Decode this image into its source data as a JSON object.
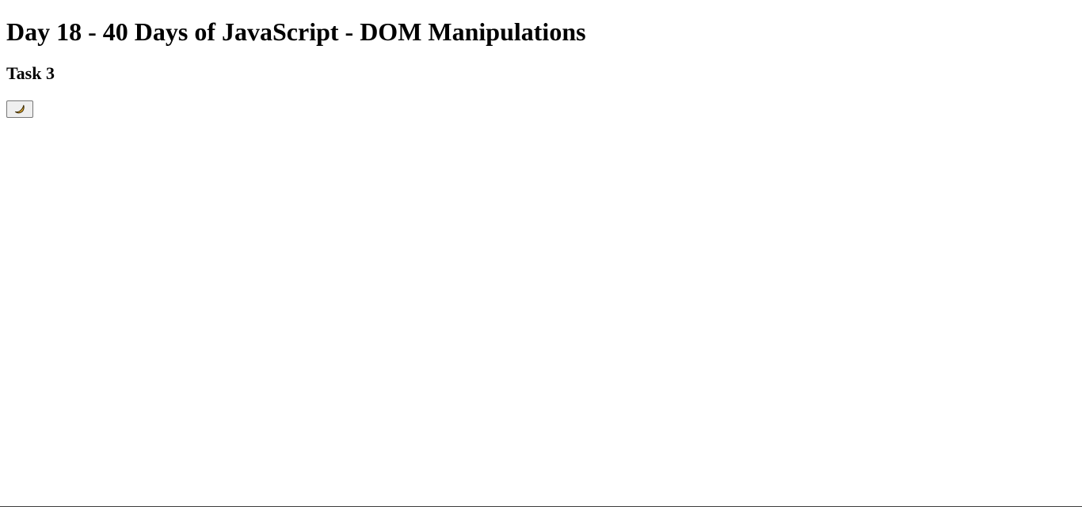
{
  "page": {
    "title": "Day 18 - 40 Days of JavaScript - DOM Manipulations",
    "task_heading": "Task 3"
  },
  "theme_toggle": {
    "icon": "crescent-moon-icon",
    "icon_color": "#f4b73a",
    "icon_outline": "#3a2a00"
  }
}
